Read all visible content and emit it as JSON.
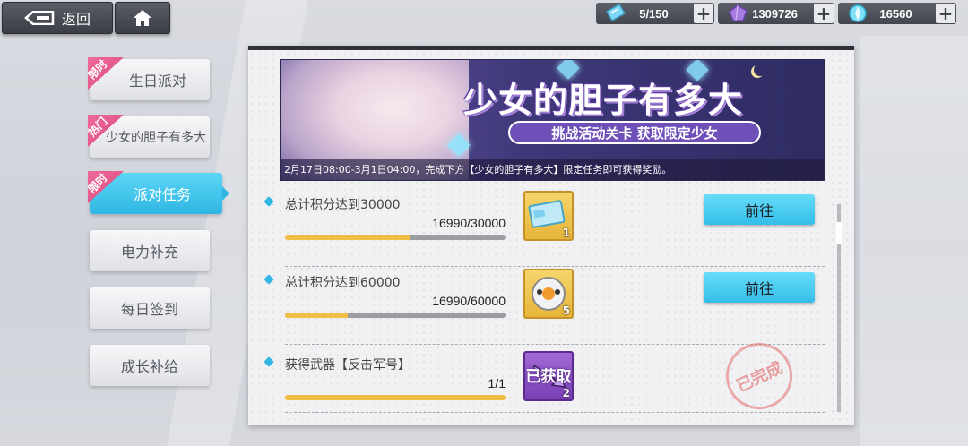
{
  "top": {
    "back_label": "返回"
  },
  "resources": [
    {
      "name": "tickets",
      "value": "5/150"
    },
    {
      "name": "crystals",
      "value": "1309726"
    },
    {
      "name": "gems",
      "value": "16560"
    }
  ],
  "sidebar": {
    "items": [
      {
        "label": "生日派对",
        "tag": "限时"
      },
      {
        "label": "少女的胆子有多大",
        "tag": "热门"
      },
      {
        "label": "派对任务",
        "tag": "限时"
      },
      {
        "label": "电力补充",
        "tag": ""
      },
      {
        "label": "每日签到",
        "tag": ""
      },
      {
        "label": "成长补给",
        "tag": ""
      }
    ]
  },
  "banner": {
    "title": "少女的胆子有多大",
    "subtitle": "挑战活动关卡  获取限定少女",
    "note": "2月17日08:00-3月1日04:00，完成下方【少女的胆子有多大】限定任务即可获得奖励。"
  },
  "tasks": [
    {
      "name": "总计积分达到30000",
      "progress_text": "16990/30000",
      "progress": 0.566,
      "reward_count": "1",
      "action": "前往"
    },
    {
      "name": "总计积分达到60000",
      "progress_text": "16990/60000",
      "progress": 0.283,
      "reward_count": "5",
      "action": "前往"
    },
    {
      "name": "获得武器【反击军号】",
      "progress_text": "1/1",
      "progress": 1.0,
      "reward_count": "2",
      "owned_label": "已获取",
      "stamp": "已完成"
    }
  ],
  "colors": {
    "accent": "#2fb6e3",
    "tag": "#e25a8c",
    "progress": "#f1bd45"
  }
}
